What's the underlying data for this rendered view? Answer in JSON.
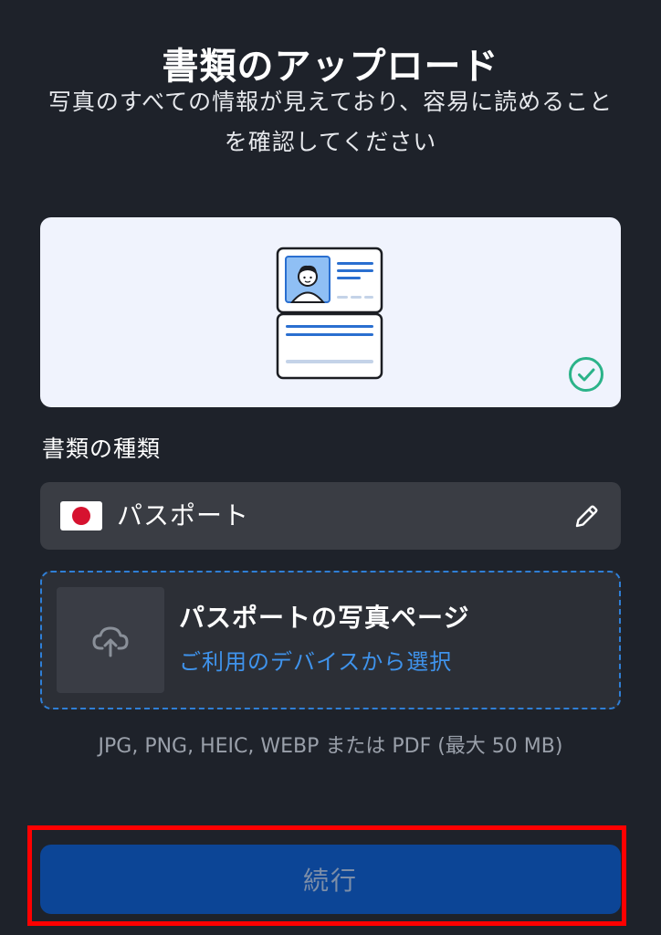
{
  "header": {
    "title": "書類のアップロード",
    "subtitle": "写真のすべての情報が見えており、容易に読めることを確認してください"
  },
  "illustration": {
    "icon": "passport-illustration",
    "status_icon": "check-circle-icon"
  },
  "document_type": {
    "label": "書類の種類",
    "selected": "パスポート",
    "flag_icon": "japan-flag-icon",
    "edit_icon": "pencil-icon"
  },
  "upload": {
    "title": "パスポートの写真ページ",
    "link": "ご利用のデバイスから選択",
    "icon": "cloud-upload-icon"
  },
  "file_hint": "JPG, PNG, HEIC, WEBP または PDF (最大 50 MB)",
  "footer": {
    "continue_label": "続行"
  },
  "colors": {
    "background": "#1e222a",
    "accent_blue": "#3f93ec",
    "button_bg": "#0c4596",
    "check_green": "#2bb389",
    "highlight_red": "#ff0000"
  }
}
